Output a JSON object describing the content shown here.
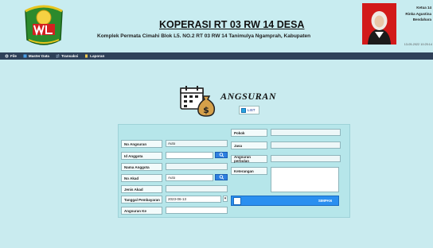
{
  "header": {
    "title": "KOPERASI RT 03 RW 14 DESA",
    "address": "Komplek Permata Cimahi Blok L5. NO.2 RT 03 RW 14 Tanimulya Ngamprah, Kabupaten",
    "user_role_1": "Ketua 14",
    "user_name": "Rinka Agustina",
    "user_role_2": "Bendahara",
    "datetime": "13-05-2022 10:25:14"
  },
  "menu": {
    "items": [
      {
        "label": "File",
        "icon": "gear-icon",
        "color": "#cfd8e0"
      },
      {
        "label": "Master Data",
        "icon": "database-icon",
        "color": "#4aa0e8"
      },
      {
        "label": "Transaksi",
        "icon": "exchange-icon",
        "color": "#9fb8d0"
      },
      {
        "label": "Laporan",
        "icon": "report-icon",
        "color": "#f2c94c"
      }
    ]
  },
  "form": {
    "title": "ANGSURAN",
    "list_label": "LIST"
  },
  "fields": {
    "no_angsuran": {
      "label": "No Angsuran",
      "value": "Auto"
    },
    "id_anggota": {
      "label": "Id Anggota",
      "value": ""
    },
    "nama_anggota": {
      "label": "Nama Anggota",
      "value": ""
    },
    "no_akad": {
      "label": "No Akad",
      "value": "Auto"
    },
    "jenis_akad": {
      "label": "Jenis Akad",
      "value": ""
    },
    "tanggal_pembayaran": {
      "label": "Tanggal Pembayaran",
      "value": "2023-06-13"
    },
    "angsuran_ke": {
      "label": "Angsuran Ke",
      "value": ""
    },
    "pokok": {
      "label": "Pokok",
      "value": ""
    },
    "jasa": {
      "label": "Jasa",
      "value": ""
    },
    "angsuran_perbulan": {
      "label": "Angsuran perbulan",
      "value": ""
    },
    "keterangan": {
      "label": "Keterangan",
      "value": ""
    }
  },
  "buttons": {
    "save_label": "SIMPAN"
  },
  "colors": {
    "background": "#c9ebef",
    "menubar": "#2f4159",
    "accent_blue": "#2a8ff0"
  }
}
